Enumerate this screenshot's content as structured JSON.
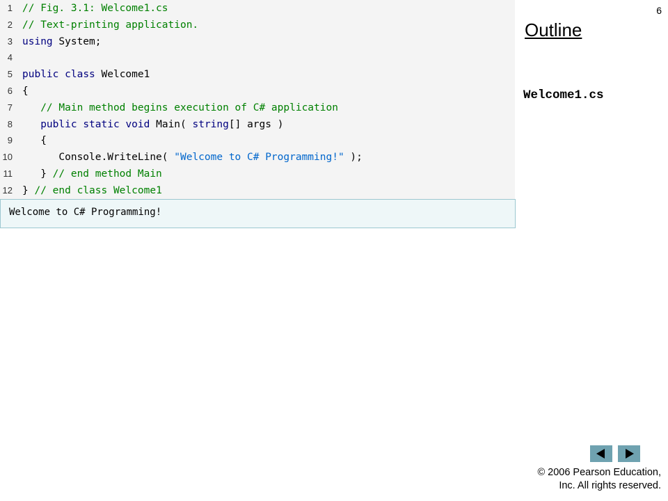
{
  "slide": {
    "number": "6",
    "outline_title": "Outline",
    "filename": "Welcome1.cs"
  },
  "code": {
    "lines": [
      {
        "num": "1",
        "segments": [
          {
            "t": "// Fig. 3.1: Welcome1.cs",
            "c": "cm"
          }
        ]
      },
      {
        "num": "2",
        "segments": [
          {
            "t": "// Text-printing application.",
            "c": "cm"
          }
        ]
      },
      {
        "num": "3",
        "segments": [
          {
            "t": "using",
            "c": "kw"
          },
          {
            "t": " System;",
            "c": ""
          }
        ]
      },
      {
        "num": "4",
        "segments": []
      },
      {
        "num": "5",
        "segments": [
          {
            "t": "public",
            "c": "kw"
          },
          {
            "t": " ",
            "c": ""
          },
          {
            "t": "class",
            "c": "kw"
          },
          {
            "t": " Welcome1",
            "c": ""
          }
        ]
      },
      {
        "num": "6",
        "segments": [
          {
            "t": "{",
            "c": ""
          }
        ]
      },
      {
        "num": "7",
        "segments": [
          {
            "t": "   // Main method begins execution of C# application",
            "c": "cm"
          }
        ]
      },
      {
        "num": "8",
        "segments": [
          {
            "t": "   ",
            "c": ""
          },
          {
            "t": "public",
            "c": "kw"
          },
          {
            "t": " ",
            "c": ""
          },
          {
            "t": "static",
            "c": "kw"
          },
          {
            "t": " ",
            "c": ""
          },
          {
            "t": "void",
            "c": "kw"
          },
          {
            "t": " Main( ",
            "c": ""
          },
          {
            "t": "string",
            "c": "kw"
          },
          {
            "t": "[] args )",
            "c": ""
          }
        ]
      },
      {
        "num": "9",
        "segments": [
          {
            "t": "   {",
            "c": ""
          }
        ]
      },
      {
        "num": "10",
        "segments": [
          {
            "t": "      Console.WriteLine( ",
            "c": ""
          },
          {
            "t": "\"Welcome to C# Programming!\"",
            "c": "st"
          },
          {
            "t": " );",
            "c": ""
          }
        ]
      },
      {
        "num": "11",
        "segments": [
          {
            "t": "   } ",
            "c": ""
          },
          {
            "t": "// end method Main",
            "c": "cm"
          }
        ]
      },
      {
        "num": "12",
        "segments": [
          {
            "t": "} ",
            "c": ""
          },
          {
            "t": "// end class Welcome1",
            "c": "cm"
          }
        ]
      }
    ]
  },
  "output": {
    "text": "Welcome to C# Programming!"
  },
  "nav": {
    "prev_icon": "triangle-left-icon",
    "next_icon": "triangle-right-icon"
  },
  "footer": {
    "line1": "© 2006 Pearson Education,",
    "line2": "Inc.  All rights reserved."
  },
  "colors": {
    "comment": "#008000",
    "keyword": "#00007f",
    "string": "#0066cc",
    "nav_button": "#6fa2b0"
  }
}
